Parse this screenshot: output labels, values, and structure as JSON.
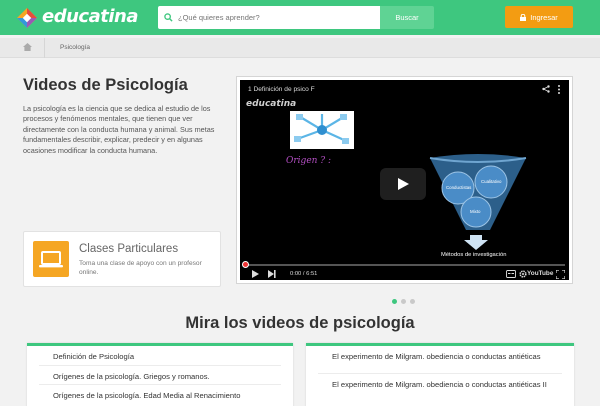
{
  "header": {
    "logo_text": "educatina",
    "search_placeholder": "¿Qué quieres aprender?",
    "search_button": "Buscar",
    "login_button": "Ingresar",
    "colors": {
      "brand_green": "#3ec77f",
      "login_orange": "#f39c12"
    }
  },
  "breadcrumb": {
    "current": "Psicología"
  },
  "main": {
    "title": "Videos de Psicología",
    "description": "La psicología es la ciencia que se dedica al estudio de los procesos y fenómenos mentales, que tienen que ver directamente con la conducta humana y animal. Sus metas fundamentales describir, explicar, predecir y en algunas ocasiones modificar la conducta humana."
  },
  "promo": {
    "title": "Clases Particulares",
    "subtitle": "Toma una clase de apoyo con un profesor online.",
    "icon": "laptop-icon"
  },
  "video": {
    "title": "1   Definición de psico F",
    "brand": "educatina",
    "handwritten": "Origen ? :",
    "diagram_caption": "Métodos de investigación",
    "diagram_labels": [
      "Conductistas",
      "Cualitativo",
      "Mixto"
    ],
    "time": "0:00 / 6:51",
    "youtube_label": "YouTube",
    "progress": 0
  },
  "carousel": {
    "count": 3,
    "active": 0
  },
  "videos_section": {
    "title": "Mira los videos de psicología",
    "left": [
      "Definición de Psicología",
      "Orígenes de la psicología. Griegos y romanos.",
      "Orígenes de la psicología. Edad Media al Renacimiento"
    ],
    "right": [
      "El experimento de Milgram. obediencia o conductas antiéticas",
      "El experimento de Milgram. obediencia o conductas antiéticas II"
    ]
  }
}
